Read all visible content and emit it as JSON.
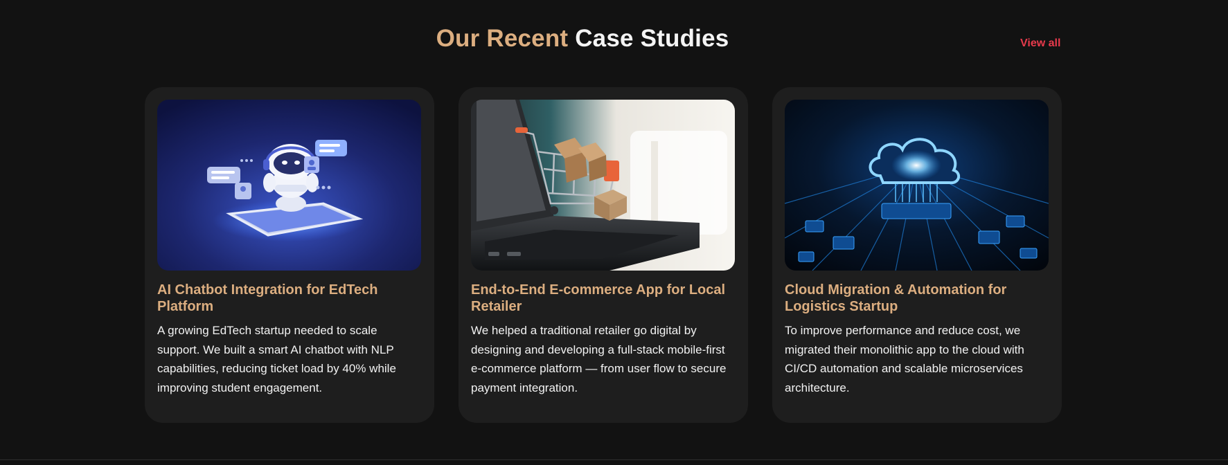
{
  "section": {
    "title_accent": "Our Recent",
    "title_main": "Case Studies",
    "view_all_label": "View all"
  },
  "colors": {
    "background": "#121212",
    "card_background": "#1e1e1e",
    "accent": "#dcae80",
    "link": "#e83a4c",
    "text": "#f2f2f2"
  },
  "cards": [
    {
      "title": "AI Chatbot Integration for EdTech Platform",
      "description": "A growing EdTech startup needed to scale support. We built a smart AI chatbot with NLP capabilities, reducing ticket load by 40% while improving student engagement.",
      "image_icon": "robot-chatbot-image"
    },
    {
      "title": "End-to-End E-commerce App for Local Retailer",
      "description": "We helped a traditional retailer go digital by designing and developing a full-stack mobile-first e-commerce platform — from user flow to secure payment integration.",
      "image_icon": "shopping-cart-laptop-image"
    },
    {
      "title": "Cloud Migration & Automation for Logistics Startup",
      "description": "To improve performance and reduce cost, we migrated their monolithic app to the cloud with CI/CD automation and scalable microservices architecture.",
      "image_icon": "cloud-circuit-image"
    }
  ]
}
